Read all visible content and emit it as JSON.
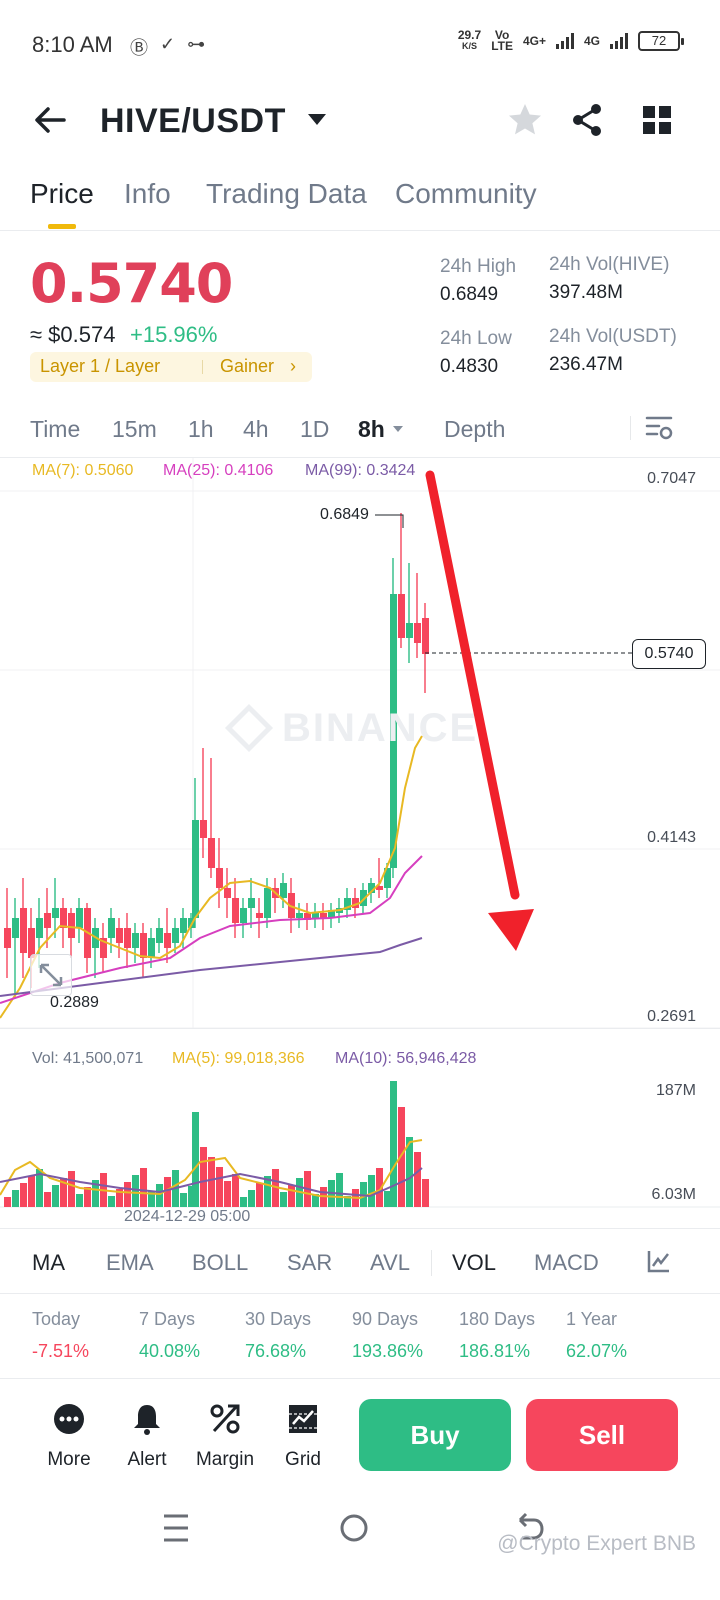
{
  "status_bar": {
    "time": "8:10 AM",
    "speed_value": "29.7",
    "speed_unit": "K/S",
    "vo_lte_top": "Vo",
    "vo_lte_bottom": "LTE",
    "net1": "4G+",
    "net2": "4G",
    "battery": "72"
  },
  "header": {
    "pair": "HIVE/USDT"
  },
  "tabs": [
    "Price",
    "Info",
    "Trading Data",
    "Community"
  ],
  "price_block": {
    "last_price": "0.5740",
    "fiat_price": "≈ $0.574",
    "change_pct": "+15.96%",
    "tag1": "Layer 1 / Layer",
    "tag2": "Gainer",
    "stats": {
      "high_label": "24h High",
      "high_value": "0.6849",
      "low_label": "24h Low",
      "low_value": "0.4830",
      "vol_base_label": "24h Vol(HIVE)",
      "vol_base_value": "397.48M",
      "vol_quote_label": "24h Vol(USDT)",
      "vol_quote_value": "236.47M"
    }
  },
  "intervals": [
    "Time",
    "15m",
    "1h",
    "4h",
    "1D",
    "8h",
    "Depth"
  ],
  "chart_legend": {
    "ma7": "MA(7): 0.5060",
    "ma25": "MA(25): 0.4106",
    "ma99": "MA(99): 0.3424"
  },
  "price_axis": {
    "top": "0.7047",
    "mid": "0.4143",
    "bottom": "0.2691",
    "current": "0.5740"
  },
  "chart_annotations": {
    "high": "0.6849",
    "low": "0.2889",
    "watermark": "BINANCE"
  },
  "volume_legend": {
    "vol": "Vol: 41,500,071",
    "ma5": "MA(5): 99,018,366",
    "ma10": "MA(10): 56,946,428",
    "axis_top": "187M",
    "axis_bottom": "6.03M",
    "time_label": "2024-12-29 05:00"
  },
  "indicator_tabs": [
    "MA",
    "EMA",
    "BOLL",
    "SAR",
    "AVL",
    "VOL",
    "MACD"
  ],
  "performance": [
    {
      "label": "Today",
      "value": "-7.51%"
    },
    {
      "label": "7 Days",
      "value": "40.08%"
    },
    {
      "label": "30 Days",
      "value": "76.68%"
    },
    {
      "label": "90 Days",
      "value": "193.86%"
    },
    {
      "label": "180 Days",
      "value": "186.81%"
    },
    {
      "label": "1 Year",
      "value": "62.07%"
    }
  ],
  "actions": {
    "more": "More",
    "alert": "Alert",
    "margin": "Margin",
    "grid": "Grid",
    "buy": "Buy",
    "sell": "Sell"
  },
  "footer_watermark": "@Crypto Expert BNB",
  "colors": {
    "up": "#2ebd85",
    "down": "#f6465d",
    "accent": "#f0b90b",
    "ma7": "#e8b923",
    "ma25": "#d63fbf",
    "ma99": "#7b5ba6",
    "arrow": "#f0212b"
  }
}
